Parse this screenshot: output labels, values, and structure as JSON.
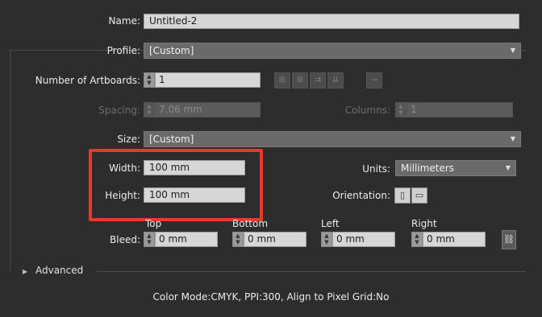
{
  "name": {
    "label": "Name:",
    "value": "Untitled-2"
  },
  "profile": {
    "label": "Profile:",
    "value": "[Custom]"
  },
  "artboards": {
    "label": "Number of Artboards:",
    "value": "1"
  },
  "spacing": {
    "label": "Spacing:",
    "value": "7.06 mm"
  },
  "columns": {
    "label": "Columns:",
    "value": "1"
  },
  "size": {
    "label": "Size:",
    "value": "[Custom]"
  },
  "width": {
    "label": "Width:",
    "value": "100 mm"
  },
  "height": {
    "label": "Height:",
    "value": "100 mm"
  },
  "units": {
    "label": "Units:",
    "value": "Millimeters"
  },
  "orientation": {
    "label": "Orientation:"
  },
  "bleed": {
    "label": "Bleed:",
    "top": {
      "label": "Top",
      "value": "0 mm"
    },
    "bottom": {
      "label": "Bottom",
      "value": "0 mm"
    },
    "left": {
      "label": "Left",
      "value": "0 mm"
    },
    "right": {
      "label": "Right",
      "value": "0 mm"
    }
  },
  "advanced": {
    "label": "Advanced"
  },
  "footer": {
    "summary": "Color Mode:CMYK, PPI:300, Align to Pixel Grid:No"
  },
  "colors": {
    "highlight": "#e63a2b",
    "background": "#2d2d2d"
  }
}
